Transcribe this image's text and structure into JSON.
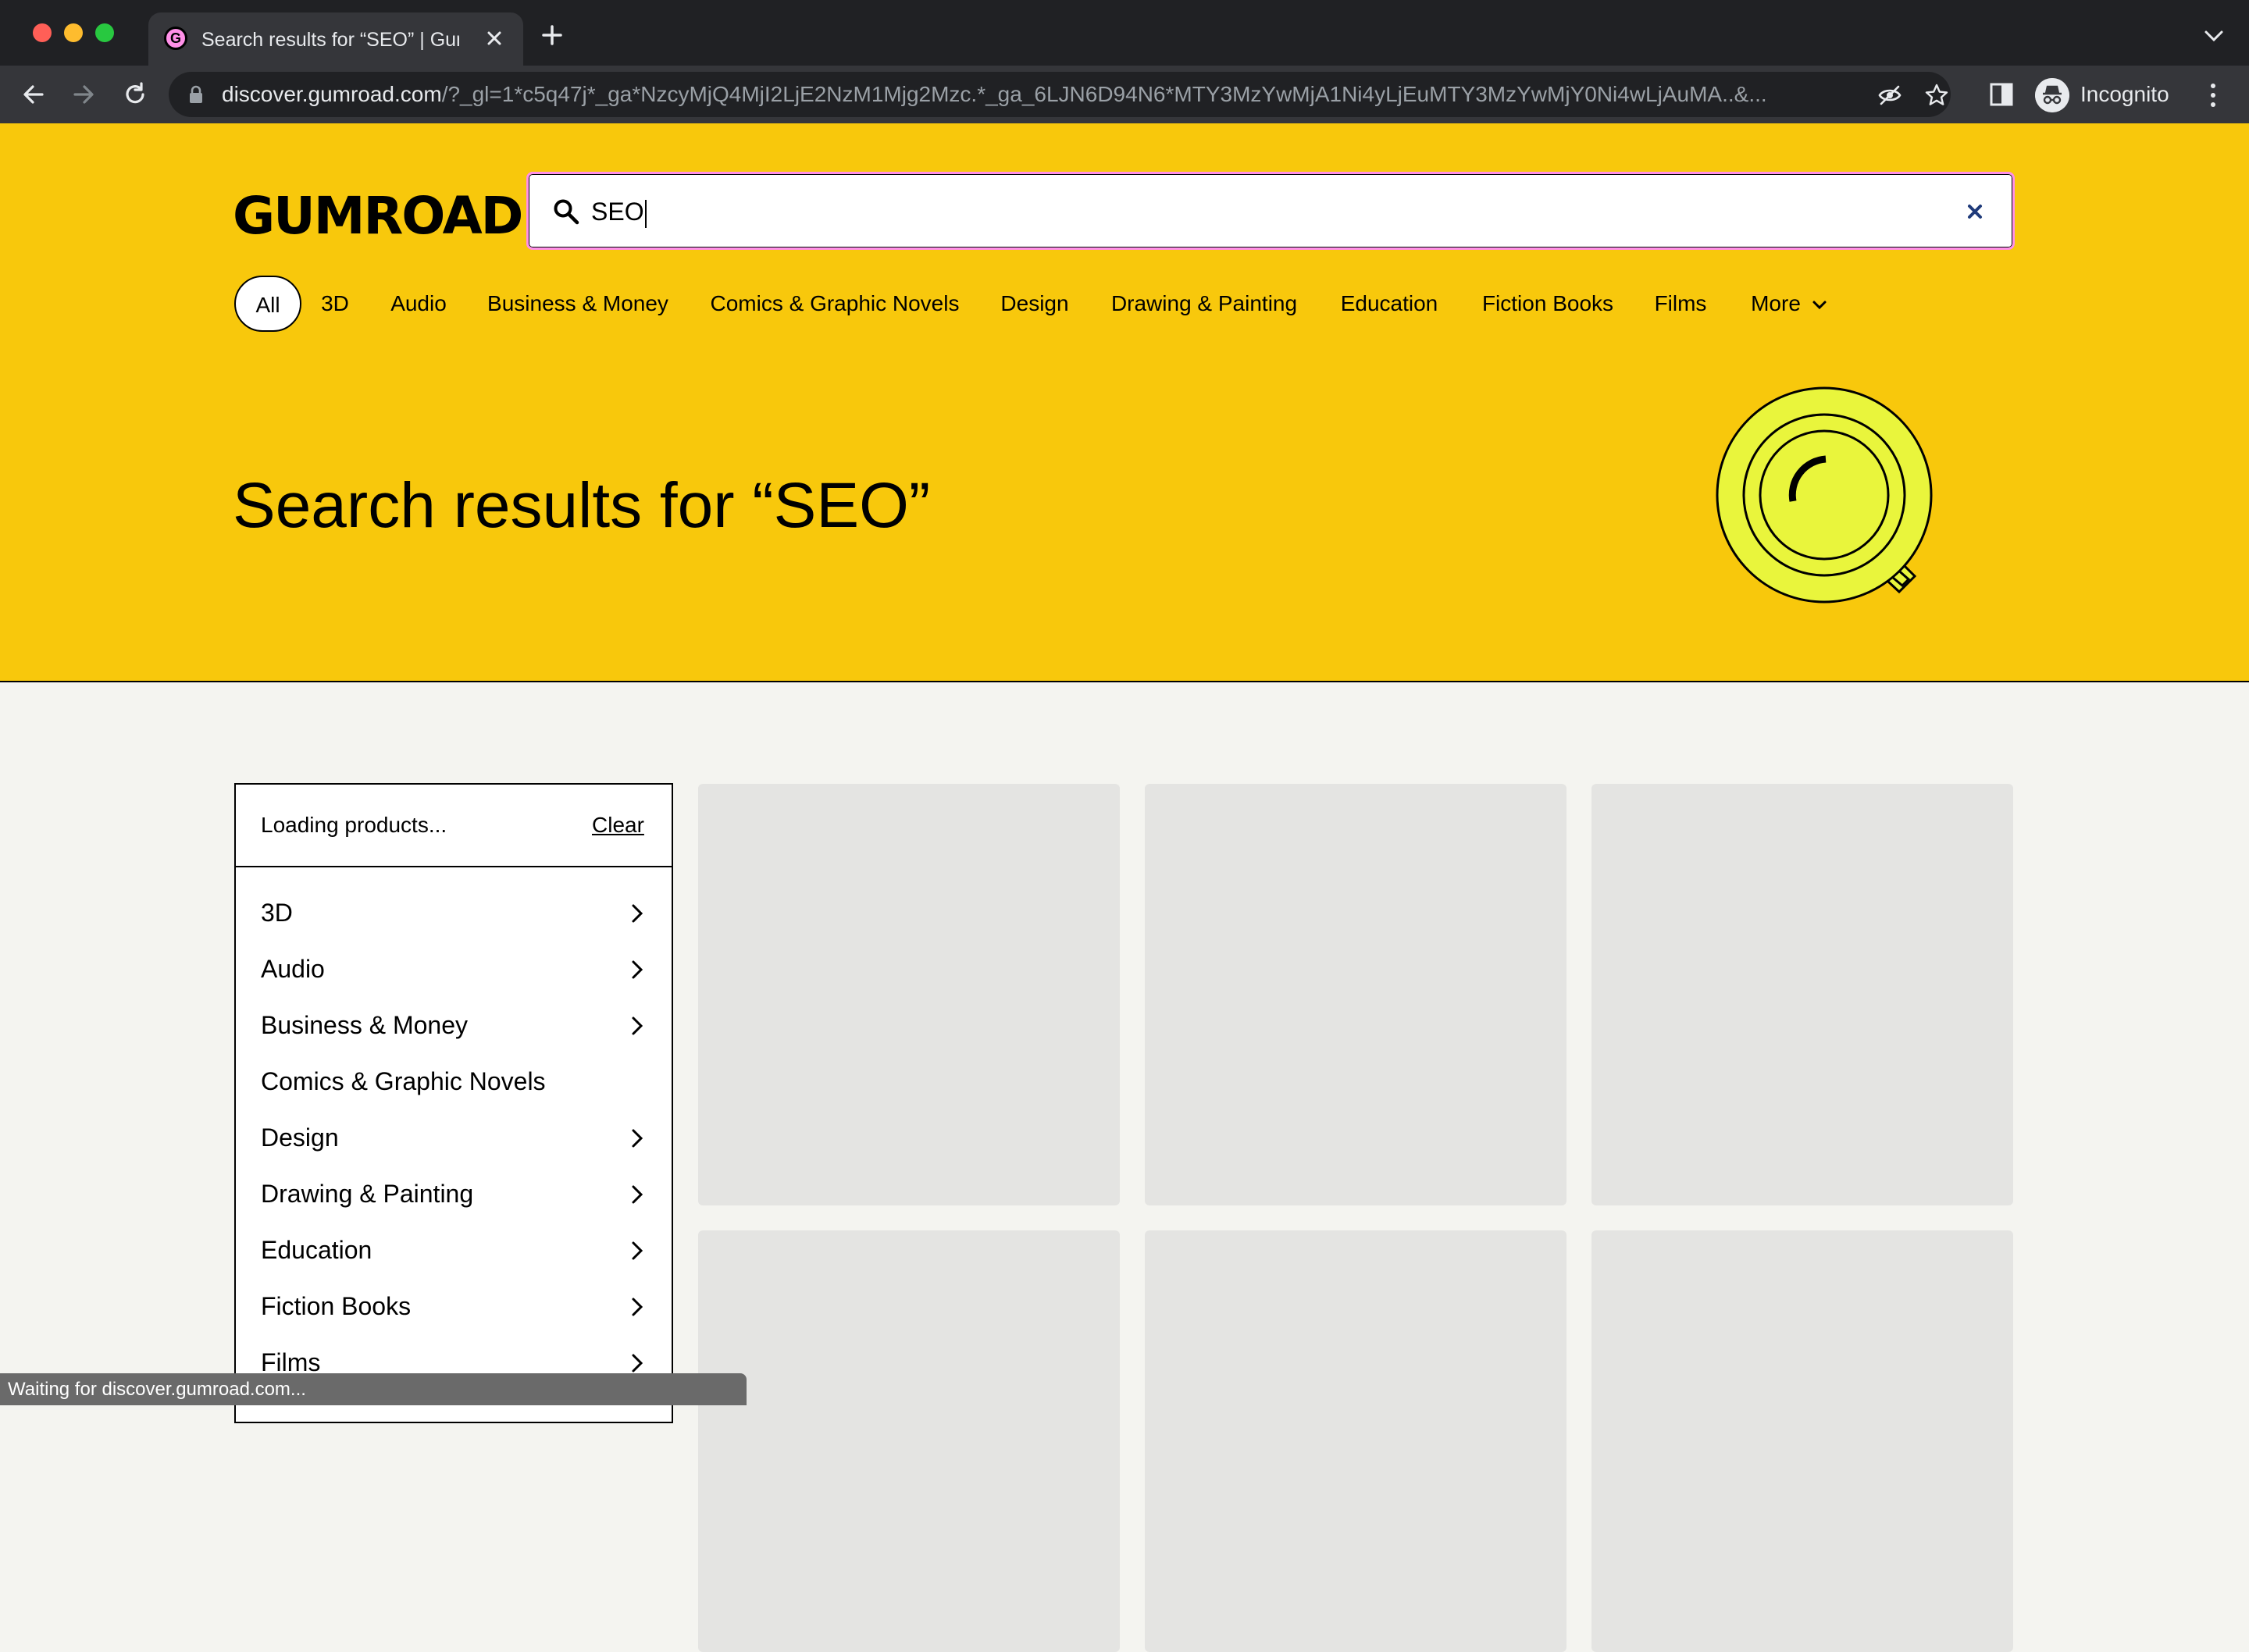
{
  "browser": {
    "tab_title": "Search results for “SEO” | Gum",
    "tab_favicon": "G",
    "url_host": "discover.gumroad.com",
    "url_rest": "/?_gl=1*c5q47j*_ga*NzcyMjQ4MjI2LjE2NzM1Mjg2Mzc.*_ga_6LJN6D94N6*MTY3MzYwMjA1Ni4yLjEuMTY3MzYwMjY0Ni4wLjAuMA..&...",
    "profile_label": "Incognito",
    "status_text": "Waiting for discover.gumroad.com..."
  },
  "header": {
    "logo": "GUMROAD",
    "search_value": "SEO",
    "categories": [
      "All",
      "3D",
      "Audio",
      "Business & Money",
      "Comics & Graphic Novels",
      "Design",
      "Drawing & Painting",
      "Education",
      "Fiction Books",
      "Films"
    ],
    "more_label": "More",
    "hero_title": "Search results for “SEO”"
  },
  "filters": {
    "loading_text": "Loading products...",
    "clear_label": "Clear",
    "items": [
      {
        "label": "3D",
        "has_children": true
      },
      {
        "label": "Audio",
        "has_children": true
      },
      {
        "label": "Business & Money",
        "has_children": true
      },
      {
        "label": "Comics & Graphic Novels",
        "has_children": false
      },
      {
        "label": "Design",
        "has_children": true
      },
      {
        "label": "Drawing & Painting",
        "has_children": true
      },
      {
        "label": "Education",
        "has_children": true
      },
      {
        "label": "Fiction Books",
        "has_children": true
      },
      {
        "label": "Films",
        "has_children": true
      }
    ]
  },
  "colors": {
    "brand_yellow": "#f8c80c",
    "brand_pink": "#ff90e8",
    "illustration_lime": "#e9f53c",
    "skeleton": "#e4e4e2"
  },
  "icons": [
    "back-arrow-icon",
    "forward-arrow-icon",
    "reload-icon",
    "lock-icon",
    "eye-off-icon",
    "star-icon",
    "side-panel-icon",
    "incognito-icon",
    "kebab-menu-icon",
    "search-icon",
    "close-icon",
    "chevron-down-icon",
    "chevron-right-icon",
    "magnifier-illustration"
  ]
}
